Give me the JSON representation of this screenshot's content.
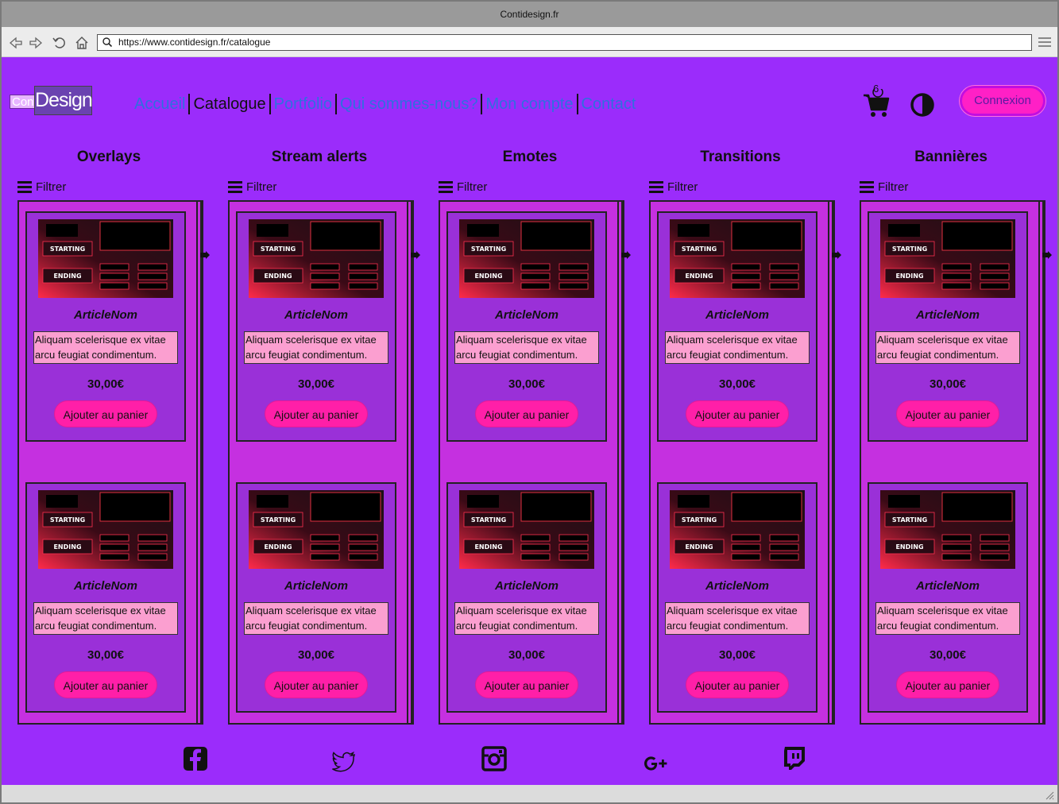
{
  "browser": {
    "title": "Contidesign.fr",
    "url": "https://www.contidesign.fr/catalogue"
  },
  "site": {
    "logo_left": "Conti",
    "logo_right": "Design",
    "nav": [
      "Accueil",
      "Catalogue",
      "Portfolio",
      "Qui sommes-nous?",
      "Mon compte",
      "Contact"
    ],
    "active_nav": "Catalogue",
    "cart_count": "6",
    "login_label": "Connexion"
  },
  "catalogue": {
    "filter_label": "Filtrer",
    "columns": [
      {
        "title": "Overlays"
      },
      {
        "title": "Stream alerts"
      },
      {
        "title": "Emotes"
      },
      {
        "title": "Transitions"
      },
      {
        "title": "Bannières"
      }
    ],
    "card": {
      "name": "ArticleNom",
      "description": "Aliquam scelerisque ex vitae arcu feugiat condimentum.",
      "price": "30,00€",
      "button": "Ajouter au panier",
      "thumb_starting": "STARTING",
      "thumb_ending": "ENDING"
    }
  },
  "footer": {
    "icons": [
      "facebook-icon",
      "twitter-icon",
      "instagram-icon",
      "google-plus-icon",
      "twitch-icon"
    ]
  },
  "colors": {
    "page_bg": "#9b2cfb",
    "panel_bg": "#c530e0",
    "card_bg": "#9a30d8",
    "button_pink": "#ff1fa8",
    "desc_bg": "#fb9fd0",
    "nav_link": "#2f6fe0"
  }
}
